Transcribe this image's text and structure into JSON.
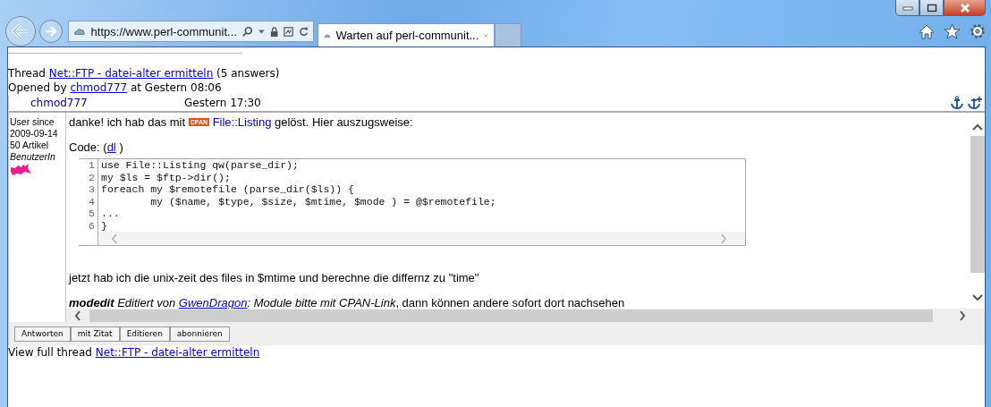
{
  "browser": {
    "url": "https://www.perl-communit...",
    "tabs": [
      {
        "title": "Warten auf perl-communit...",
        "selected": true
      }
    ]
  },
  "thread": {
    "prefix": "Thread",
    "title": "Net::FTP - datei-alter ermitteln",
    "answers": "(5 answers)",
    "opened_prefix": "Opened by",
    "opener": "chmod777",
    "opened_at": "at Gestern 08:06"
  },
  "post": {
    "author": "chmod777",
    "time": "Gestern 17:30",
    "user_info": {
      "since_label": "User since",
      "since": "2009-09-14",
      "articles": "50 Artikel",
      "role": "BenutzerIn"
    },
    "intro_before": "danke! ich hab das mit",
    "cpan_badge": "CPAN",
    "module": "File::Listing",
    "intro_after": "gelöst. Hier auszugsweise:",
    "code_label": "Code: (",
    "code_link": "dl",
    "code_label_end": " )",
    "code_lines": [
      {
        "number": "1",
        "text": "use File::Listing qw(parse_dir);"
      },
      {
        "number": "2",
        "text": "my $ls = $ftp->dir();"
      },
      {
        "number": "3",
        "text": "foreach my $remotefile (parse_dir($ls)) {"
      },
      {
        "number": "4",
        "text": "        my ($name, $type, $size, $mtime, $mode ) = @$remotefile;"
      },
      {
        "number": "5",
        "text": "..."
      },
      {
        "number": "6",
        "text": "}"
      }
    ],
    "followup": "jetzt hab ich die unix-zeit des files in $mtime und berechne die differnz zu \"time\"",
    "modedit": {
      "label": "modedit",
      "text_before": "Editiert von",
      "author": "GwenDragon",
      "reason": ": Module bitte mit CPAN-Link",
      "rest": ", dann können andere sofort dort nachsehen"
    }
  },
  "actions": [
    "Antworten",
    "mit Zitat",
    "Editieren",
    "abonnieren"
  ],
  "footer": {
    "prefix": "View full thread",
    "link": "Net::FTP - datei-alter ermitteln"
  }
}
